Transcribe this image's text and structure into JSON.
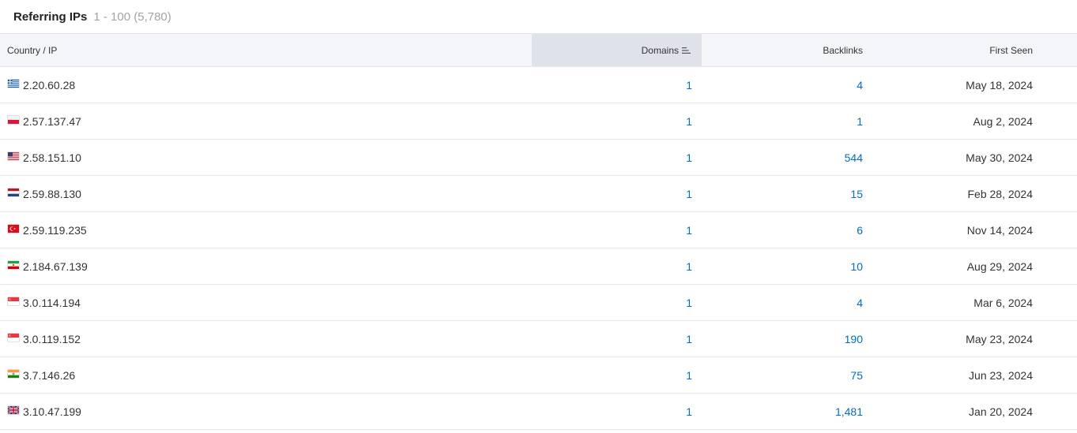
{
  "header": {
    "title": "Referring IPs",
    "range": "1 - 100 (5,780)"
  },
  "columns": {
    "country_ip": "Country / IP",
    "domains": "Domains",
    "backlinks": "Backlinks",
    "first_seen": "First Seen"
  },
  "sort": {
    "column": "domains",
    "icon": "sort-descending-icon"
  },
  "colors": {
    "link": "#006dca",
    "header_bg": "#f4f5f9",
    "active_header_bg": "#e0e2e9",
    "border": "#e4e6eb"
  },
  "rows": [
    {
      "flag": "gr",
      "ip": "2.20.60.28",
      "domains": "1",
      "backlinks": "4",
      "first_seen": "May 18, 2024"
    },
    {
      "flag": "pl",
      "ip": "2.57.137.47",
      "domains": "1",
      "backlinks": "1",
      "first_seen": "Aug 2, 2024"
    },
    {
      "flag": "us",
      "ip": "2.58.151.10",
      "domains": "1",
      "backlinks": "544",
      "first_seen": "May 30, 2024"
    },
    {
      "flag": "nl",
      "ip": "2.59.88.130",
      "domains": "1",
      "backlinks": "15",
      "first_seen": "Feb 28, 2024"
    },
    {
      "flag": "tr",
      "ip": "2.59.119.235",
      "domains": "1",
      "backlinks": "6",
      "first_seen": "Nov 14, 2024"
    },
    {
      "flag": "ir",
      "ip": "2.184.67.139",
      "domains": "1",
      "backlinks": "10",
      "first_seen": "Aug 29, 2024"
    },
    {
      "flag": "sg",
      "ip": "3.0.114.194",
      "domains": "1",
      "backlinks": "4",
      "first_seen": "Mar 6, 2024"
    },
    {
      "flag": "sg",
      "ip": "3.0.119.152",
      "domains": "1",
      "backlinks": "190",
      "first_seen": "May 23, 2024"
    },
    {
      "flag": "in",
      "ip": "3.7.146.26",
      "domains": "1",
      "backlinks": "75",
      "first_seen": "Jun 23, 2024"
    },
    {
      "flag": "gb",
      "ip": "3.10.47.199",
      "domains": "1",
      "backlinks": "1,481",
      "first_seen": "Jan 20, 2024"
    }
  ]
}
